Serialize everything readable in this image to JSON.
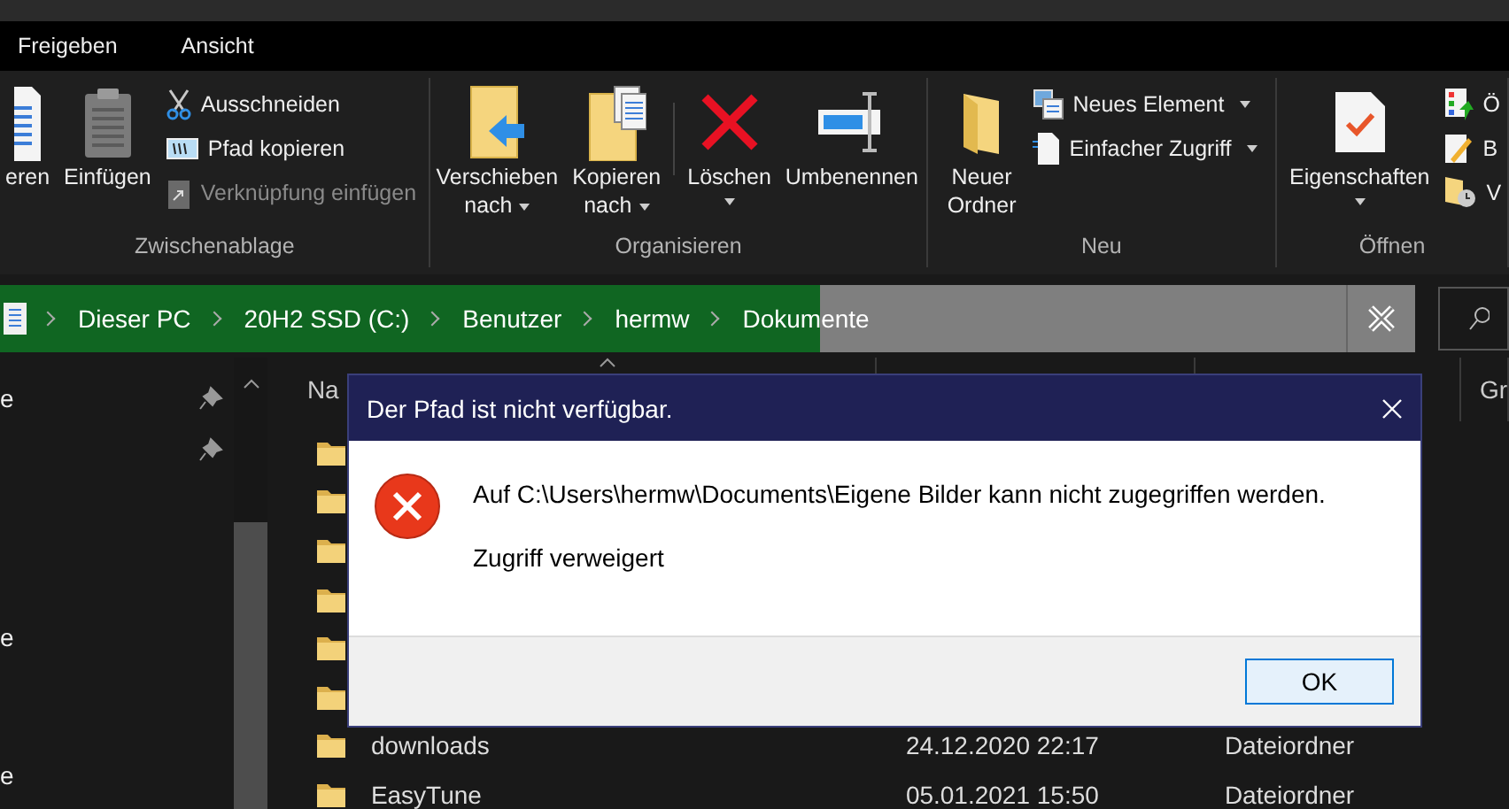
{
  "tabs": [
    {
      "label": "Freigeben",
      "selected": false
    },
    {
      "label": "Ansicht",
      "selected": false
    }
  ],
  "ribbon": {
    "groups": [
      {
        "label": "Zwischenablage",
        "items": [
          {
            "kind": "large",
            "lines": [
              "eren"
            ],
            "dropdown": false
          },
          {
            "kind": "large",
            "lines": [
              "Einfügen"
            ],
            "dropdown": false
          },
          {
            "kind": "stack",
            "entries": [
              {
                "label": "Ausschneiden",
                "dropdown": false,
                "disabled": false
              },
              {
                "label": "Pfad kopieren",
                "dropdown": false,
                "disabled": false
              },
              {
                "label": "Verknüpfung einfügen",
                "dropdown": false,
                "disabled": true
              }
            ]
          }
        ]
      },
      {
        "label": "Organisieren",
        "items": [
          {
            "kind": "large",
            "lines": [
              "Verschieben",
              "nach"
            ],
            "dropdown": true
          },
          {
            "kind": "large",
            "lines": [
              "Kopieren",
              "nach"
            ],
            "dropdown": true
          },
          {
            "kind": "separator"
          },
          {
            "kind": "large",
            "lines": [
              "Löschen"
            ],
            "dropdown": true
          },
          {
            "kind": "large",
            "lines": [
              "Umbenennen"
            ],
            "dropdown": false
          }
        ]
      },
      {
        "label": "Neu",
        "items": [
          {
            "kind": "large",
            "lines": [
              "Neuer",
              "Ordner"
            ],
            "dropdown": false
          },
          {
            "kind": "stack",
            "entries": [
              {
                "label": "Neues Element",
                "dropdown": true,
                "disabled": false
              },
              {
                "label": "Einfacher Zugriff",
                "dropdown": true,
                "disabled": false
              }
            ]
          }
        ]
      },
      {
        "label": "Öffnen",
        "items": [
          {
            "kind": "large",
            "lines": [
              "Eigenschaften"
            ],
            "dropdown": true
          },
          {
            "kind": "stack",
            "entries": [
              {
                "label": "Ö",
                "dropdown": false,
                "disabled": false
              },
              {
                "label": "B",
                "dropdown": false,
                "disabled": false
              },
              {
                "label": "V",
                "dropdown": false,
                "disabled": false
              }
            ]
          }
        ]
      }
    ]
  },
  "address_bar": {
    "breadcrumbs": [
      "Dieser PC",
      "20H2 SSD (C:)",
      "Benutzer",
      "hermw",
      "Dokumente"
    ],
    "level": 0.61
  },
  "nav_pane": {
    "items": [
      {
        "label": "e",
        "pinned": true
      },
      {
        "pinned": true
      },
      {
        "label": "e",
        "pinned": false
      },
      {
        "label": "e",
        "pinned": false
      }
    ]
  },
  "file_list": {
    "header": {
      "column_1": "Na",
      "column_4": "Gr"
    },
    "rows": [
      {
        "kind": "covered"
      },
      {
        "kind": "covered"
      },
      {
        "kind": "covered"
      },
      {
        "kind": "covered"
      },
      {
        "kind": "covered"
      },
      {
        "kind": "covered"
      },
      {
        "kind": "file",
        "name": "downloads",
        "date": "24.12.2020 22:17",
        "type": "Dateiordner"
      },
      {
        "kind": "file",
        "name": "EasyTune",
        "date": "05.01.2021 15:50",
        "type": "Dateiordner"
      }
    ]
  },
  "dialog": {
    "title": "Der Pfad ist nicht verfügbar.",
    "message": "Auf C:\\Users\\hermw\\Documents\\Eigene Bilder kann nicht zugegriffen werden.",
    "detail": "Zugriff verweigert",
    "buttons": [
      "OK"
    ]
  }
}
